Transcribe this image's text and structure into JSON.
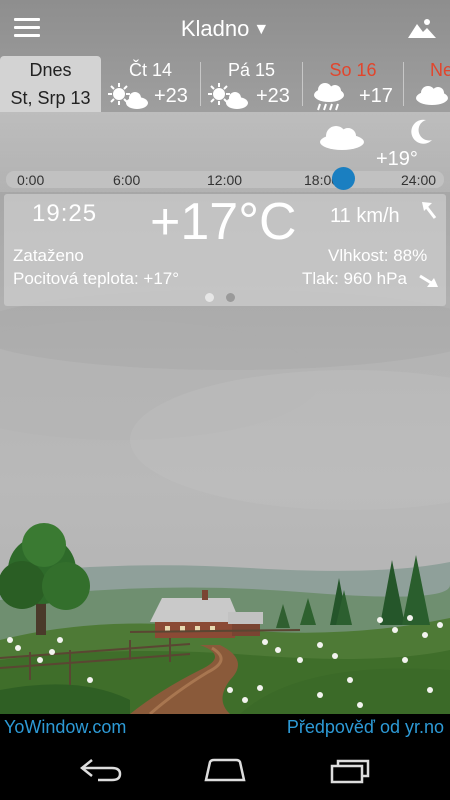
{
  "header": {
    "city": "Kladno",
    "dropdown_glyph": "▼",
    "menu_icon": "hamburger-menu-icon",
    "landscape_icon": "landscape-icon"
  },
  "days": [
    {
      "name": "Dnes",
      "date": "St, Srp 13",
      "selected": true
    },
    {
      "name": "Čt 14",
      "temp": "+23",
      "icon": "sun-cloud-icon"
    },
    {
      "name": "Pá 15",
      "temp": "+23",
      "icon": "sun-cloud-icon"
    },
    {
      "name": "So 16",
      "temp": "+17",
      "icon": "rain-cloud-icon",
      "weekend": true
    },
    {
      "name": "Ne",
      "icon": "cloud-icon",
      "weekend": true
    }
  ],
  "timeline": {
    "night_temp": "+19°",
    "ticks": [
      "0:00",
      "6:00",
      "12:00",
      "18:00",
      "24:00"
    ],
    "current_position": 0.8
  },
  "current": {
    "time": "19:25",
    "temperature": "+17°C",
    "wind": "11 km/h",
    "condition": "Zataženo",
    "feels_like": "Pocitová teplota: +17°",
    "humidity": "Vlhkost: 88%",
    "pressure": "Tlak: 960 hPa",
    "page_count": 2,
    "active_page": 1
  },
  "footer": {
    "left_link": "YoWindow.com",
    "right_link": "Předpověď od yr.no"
  },
  "colors": {
    "accent": "#1a7fc1",
    "weekend": "#e2452c",
    "link": "#2d9ad6"
  }
}
